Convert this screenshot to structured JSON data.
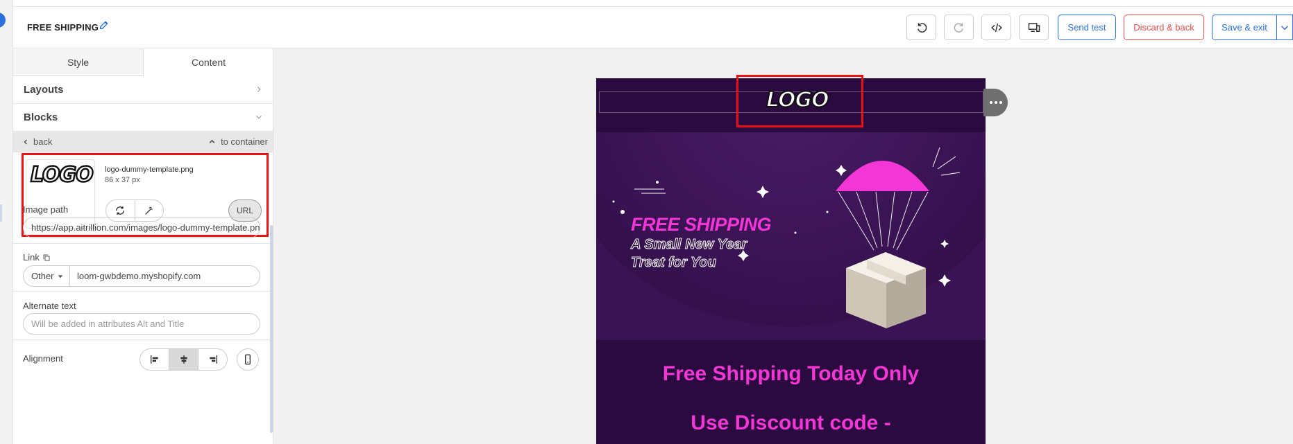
{
  "header": {
    "title": "FREE SHIPPING",
    "buttons": {
      "send_test": "Send test",
      "discard": "Discard & back",
      "save_exit": "Save & exit"
    }
  },
  "panel": {
    "tabs": [
      "Style",
      "Content"
    ],
    "active_tab": "Content",
    "sections": {
      "layouts": "Layouts",
      "blocks": "Blocks"
    },
    "nav": {
      "back": "back",
      "to_container": "to container"
    },
    "image": {
      "logo_text": "LOGO",
      "filename": "logo-dummy-template.png",
      "dimensions": "86 x 37 px",
      "url_button": "URL"
    },
    "image_path": {
      "label": "Image path",
      "value": "https://app.aitrillion.com/images/logo-dummy-template.png"
    },
    "link": {
      "label": "Link",
      "type": "Other",
      "value": "loom-gwbdemo.myshopify.com"
    },
    "alt_text": {
      "label": "Alternate text",
      "placeholder": "Will be added in attributes Alt and Title"
    },
    "alignment": {
      "label": "Alignment",
      "selected": "center"
    }
  },
  "email": {
    "logo_text": "LOGO",
    "banner_title": "FREE SHIPPING",
    "banner_sub_1": "A Small New Year",
    "banner_sub_2": "Treat for You",
    "headline_1": "Free Shipping Today Only",
    "headline_2": "Use Discount code -"
  },
  "colors": {
    "accent": "#2a6fdb",
    "danger": "#e74c4c",
    "email_bg": "#2a0a3f",
    "email_pink": "#f536d6",
    "highlight": "#e11111"
  }
}
